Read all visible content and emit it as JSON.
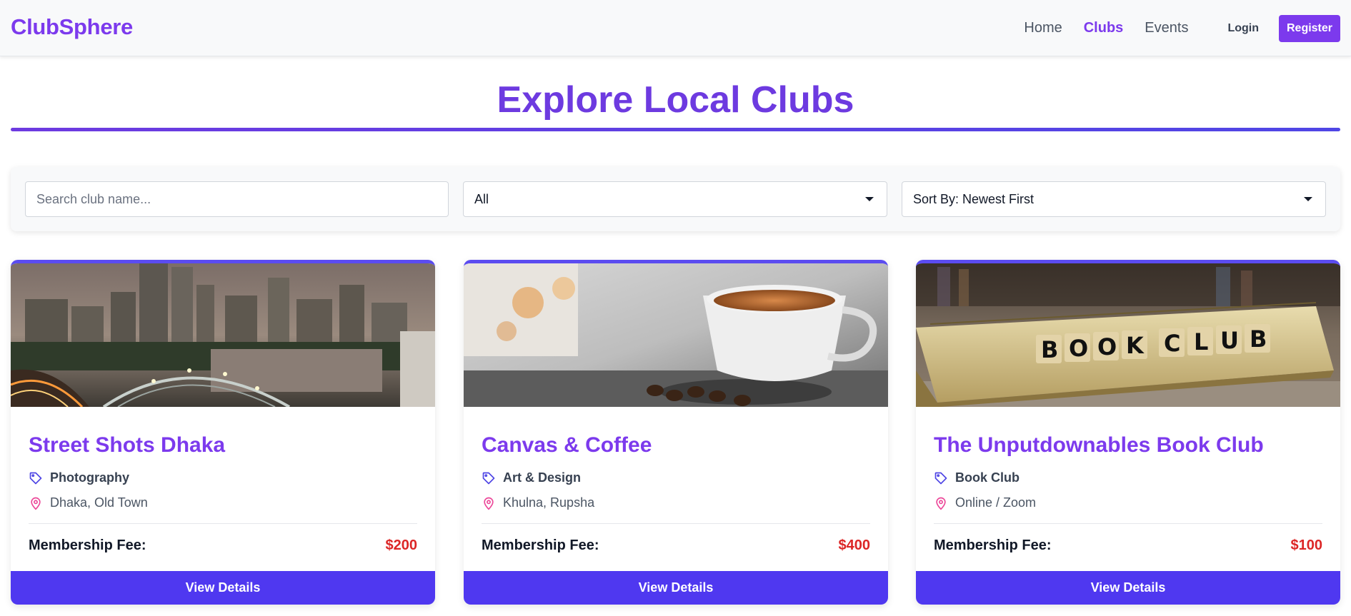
{
  "navbar": {
    "brand": "ClubSphere",
    "links": [
      {
        "label": "Home",
        "active": false
      },
      {
        "label": "Clubs",
        "active": true
      },
      {
        "label": "Events",
        "active": false
      }
    ],
    "login": "Login",
    "register": "Register"
  },
  "page": {
    "title": "Explore Local Clubs"
  },
  "filters": {
    "search_placeholder": "Search club name...",
    "search_value": "",
    "category_selected": "All",
    "sort_selected": "Sort By: Newest First"
  },
  "clubs": [
    {
      "name": "Street Shots Dhaka",
      "category": "Photography",
      "location": "Dhaka, Old Town",
      "fee_label": "Membership Fee:",
      "fee": "$200",
      "button": "View Details",
      "image": "city-night-photo"
    },
    {
      "name": "Canvas & Coffee",
      "category": "Art & Design",
      "location": "Khulna, Rupsha",
      "fee_label": "Membership Fee:",
      "fee": "$400",
      "button": "View Details",
      "image": "coffee-cup-photo"
    },
    {
      "name": "The Unputdownables Book Club",
      "category": "Book Club",
      "location": "Online / Zoom",
      "fee_label": "Membership Fee:",
      "fee": "$100",
      "button": "View Details",
      "image": "book-club-photo",
      "image_text": "BOOK CLUB"
    }
  ],
  "colors": {
    "brand": "#7c3aed",
    "button": "#4f38f0",
    "fee": "#dc2626",
    "location_icon": "#ec4899",
    "tag_icon": "#4f46e5"
  },
  "icons": {
    "category": "tag-icon",
    "location": "map-pin-icon",
    "dropdown": "caret-down-icon"
  }
}
